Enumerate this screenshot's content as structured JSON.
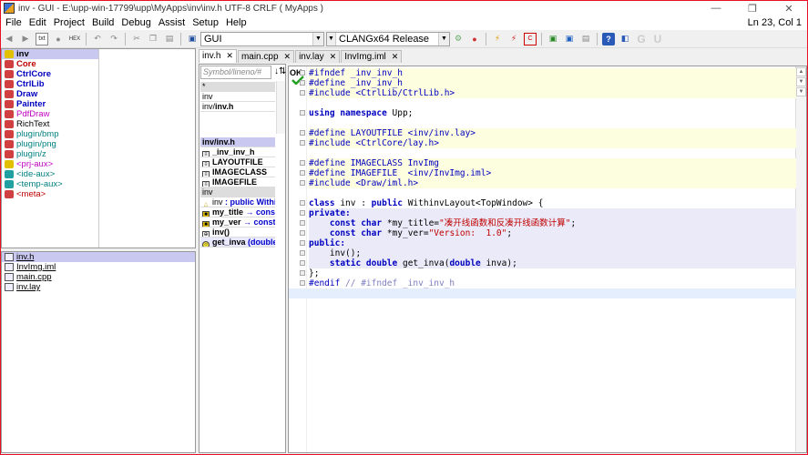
{
  "window": {
    "title": "inv - GUI - E:\\upp-win-17799\\upp\\MyApps\\inv\\inv.h UTF-8 CRLF ( MyApps )",
    "min": "—",
    "max": "❐",
    "close": "✕"
  },
  "menu": [
    "File",
    "Edit",
    "Project",
    "Build",
    "Debug",
    "Assist",
    "Setup",
    "Help"
  ],
  "position": "Ln 23, Col 1",
  "toolbar": {
    "main_config": "GUI",
    "build_method": "CLANGx64 Release"
  },
  "packages": [
    {
      "label": "inv",
      "color": "#000000",
      "icon_color": "#e0c000",
      "selected": true
    },
    {
      "label": "Core",
      "color": "#c00000",
      "icon_color": "#d04040",
      "bold": true
    },
    {
      "label": "CtrlCore",
      "color": "#0000c0",
      "icon_color": "#d04040",
      "bold": true
    },
    {
      "label": "CtrlLib",
      "color": "#0000c0",
      "icon_color": "#d04040",
      "bold": true
    },
    {
      "label": "Draw",
      "color": "#0000c0",
      "icon_color": "#d04040",
      "bold": true
    },
    {
      "label": "Painter",
      "color": "#0000c0",
      "icon_color": "#d04040",
      "bold": true
    },
    {
      "label": "PdfDraw",
      "color": "#c000c0",
      "icon_color": "#d04040"
    },
    {
      "label": "RichText",
      "color": "#000000",
      "icon_color": "#d04040"
    },
    {
      "label": "plugin/bmp",
      "color": "#008080",
      "icon_color": "#d04040"
    },
    {
      "label": "plugin/png",
      "color": "#008080",
      "icon_color": "#d04040"
    },
    {
      "label": "plugin/z",
      "color": "#008080",
      "icon_color": "#d04040"
    },
    {
      "label": "<prj-aux>",
      "color": "#c000c0",
      "icon_color": "#e0c000"
    },
    {
      "label": "<ide-aux>",
      "color": "#008080",
      "icon_color": "#20a0a0"
    },
    {
      "label": "<temp-aux>",
      "color": "#008080",
      "icon_color": "#20a0a0"
    },
    {
      "label": "<meta>",
      "color": "#c00000",
      "icon_color": "#d04040"
    }
  ],
  "files": [
    {
      "label": "inv.h",
      "selected": true
    },
    {
      "label": "InvImg.iml"
    },
    {
      "label": "main.cpp"
    },
    {
      "label": "inv.lay"
    }
  ],
  "navigator": {
    "search_placeholder": "Symbol/lineno/#",
    "sort": "↓⇅",
    "scopes": [
      "*",
      "inv",
      "inv/inv.h"
    ],
    "symbols": [
      {
        "label": "inv/inv.h",
        "kind": "head"
      },
      {
        "label": "_inv_inv_h",
        "kind": "macro"
      },
      {
        "label": "LAYOUTFILE",
        "kind": "macro"
      },
      {
        "label": "IMAGECLASS",
        "kind": "macro"
      },
      {
        "label": "IMAGEFILE",
        "kind": "macro"
      },
      {
        "label": "inv",
        "kind": "grp"
      },
      {
        "label": "inv",
        "suffix": ": public Withi",
        "kind": "class"
      },
      {
        "label": "my_title",
        "suffix": "→ const",
        "kind": "member"
      },
      {
        "label": "my_ver",
        "suffix": "→ const",
        "kind": "member"
      },
      {
        "label": "inv()",
        "kind": "ctor"
      },
      {
        "label": "get_inva",
        "suffix": "(double",
        "kind": "method"
      }
    ]
  },
  "tabs": [
    {
      "label": "inv.h",
      "active": true
    },
    {
      "label": "main.cpp"
    },
    {
      "label": "inv.lay"
    },
    {
      "label": "InvImg.iml"
    }
  ],
  "editor": {
    "status_badge": "OK",
    "lines": [
      {
        "hl": "yellow",
        "parts": [
          [
            "pp",
            "#ifndef _inv_inv_h"
          ]
        ]
      },
      {
        "hl": "yellow",
        "parts": [
          [
            "pp",
            "#define _inv_inv_h"
          ]
        ]
      },
      {
        "hl": "yellow",
        "parts": [
          [
            "pp",
            "#include <CtrlLib/CtrlLib.h>"
          ]
        ]
      },
      {
        "hl": "",
        "parts": [
          [
            "",
            ""
          ]
        ]
      },
      {
        "hl": "",
        "parts": [
          [
            "kw",
            "using namespace"
          ],
          [
            "",
            " Upp;"
          ]
        ]
      },
      {
        "hl": "",
        "parts": [
          [
            "",
            ""
          ]
        ]
      },
      {
        "hl": "yellow",
        "parts": [
          [
            "pp",
            "#define LAYOUTFILE <inv/inv.lay>"
          ]
        ]
      },
      {
        "hl": "yellow",
        "parts": [
          [
            "pp",
            "#include <CtrlCore/lay.h>"
          ]
        ]
      },
      {
        "hl": "",
        "parts": [
          [
            "",
            ""
          ]
        ]
      },
      {
        "hl": "yellow",
        "parts": [
          [
            "pp",
            "#define IMAGECLASS InvImg"
          ]
        ]
      },
      {
        "hl": "yellow",
        "parts": [
          [
            "pp",
            "#define IMAGEFILE  <inv/InvImg.iml>"
          ]
        ]
      },
      {
        "hl": "yellow",
        "parts": [
          [
            "pp",
            "#include <Draw/iml.h>"
          ]
        ]
      },
      {
        "hl": "",
        "parts": [
          [
            "",
            ""
          ]
        ]
      },
      {
        "hl": "",
        "parts": [
          [
            "kw",
            "class"
          ],
          [
            "",
            " inv : "
          ],
          [
            "kw",
            "public"
          ],
          [
            "",
            " WithinvLayout<TopWindow> {"
          ]
        ]
      },
      {
        "hl": "blue",
        "parts": [
          [
            "kw",
            "private:"
          ]
        ]
      },
      {
        "hl": "blue",
        "parts": [
          [
            "",
            "    "
          ],
          [
            "kw",
            "const char"
          ],
          [
            "",
            " *my_title="
          ],
          [
            "str",
            "\"凑开线函数和反凑开线函数计算\""
          ],
          [
            "",
            ";"
          ]
        ]
      },
      {
        "hl": "blue",
        "parts": [
          [
            "",
            "    "
          ],
          [
            "kw",
            "const char"
          ],
          [
            "",
            " *my_ver="
          ],
          [
            "str",
            "\"Version:  1.0\""
          ],
          [
            "",
            ";"
          ]
        ]
      },
      {
        "hl": "blue",
        "parts": [
          [
            "kw",
            "public:"
          ]
        ]
      },
      {
        "hl": "blue",
        "parts": [
          [
            "",
            "    inv();"
          ]
        ]
      },
      {
        "hl": "blue",
        "parts": [
          [
            "",
            "    "
          ],
          [
            "kw",
            "static double"
          ],
          [
            "",
            " get_inva("
          ],
          [
            "kw",
            "double"
          ],
          [
            "",
            " inva);"
          ]
        ]
      },
      {
        "hl": "",
        "parts": [
          [
            "",
            "};"
          ]
        ]
      },
      {
        "hl": "",
        "parts": [
          [
            "pp",
            "#endif"
          ],
          [
            "cmt",
            " // #ifndef _inv_inv_h"
          ]
        ]
      },
      {
        "hl": "cur",
        "parts": [
          [
            "",
            ""
          ]
        ]
      }
    ]
  }
}
